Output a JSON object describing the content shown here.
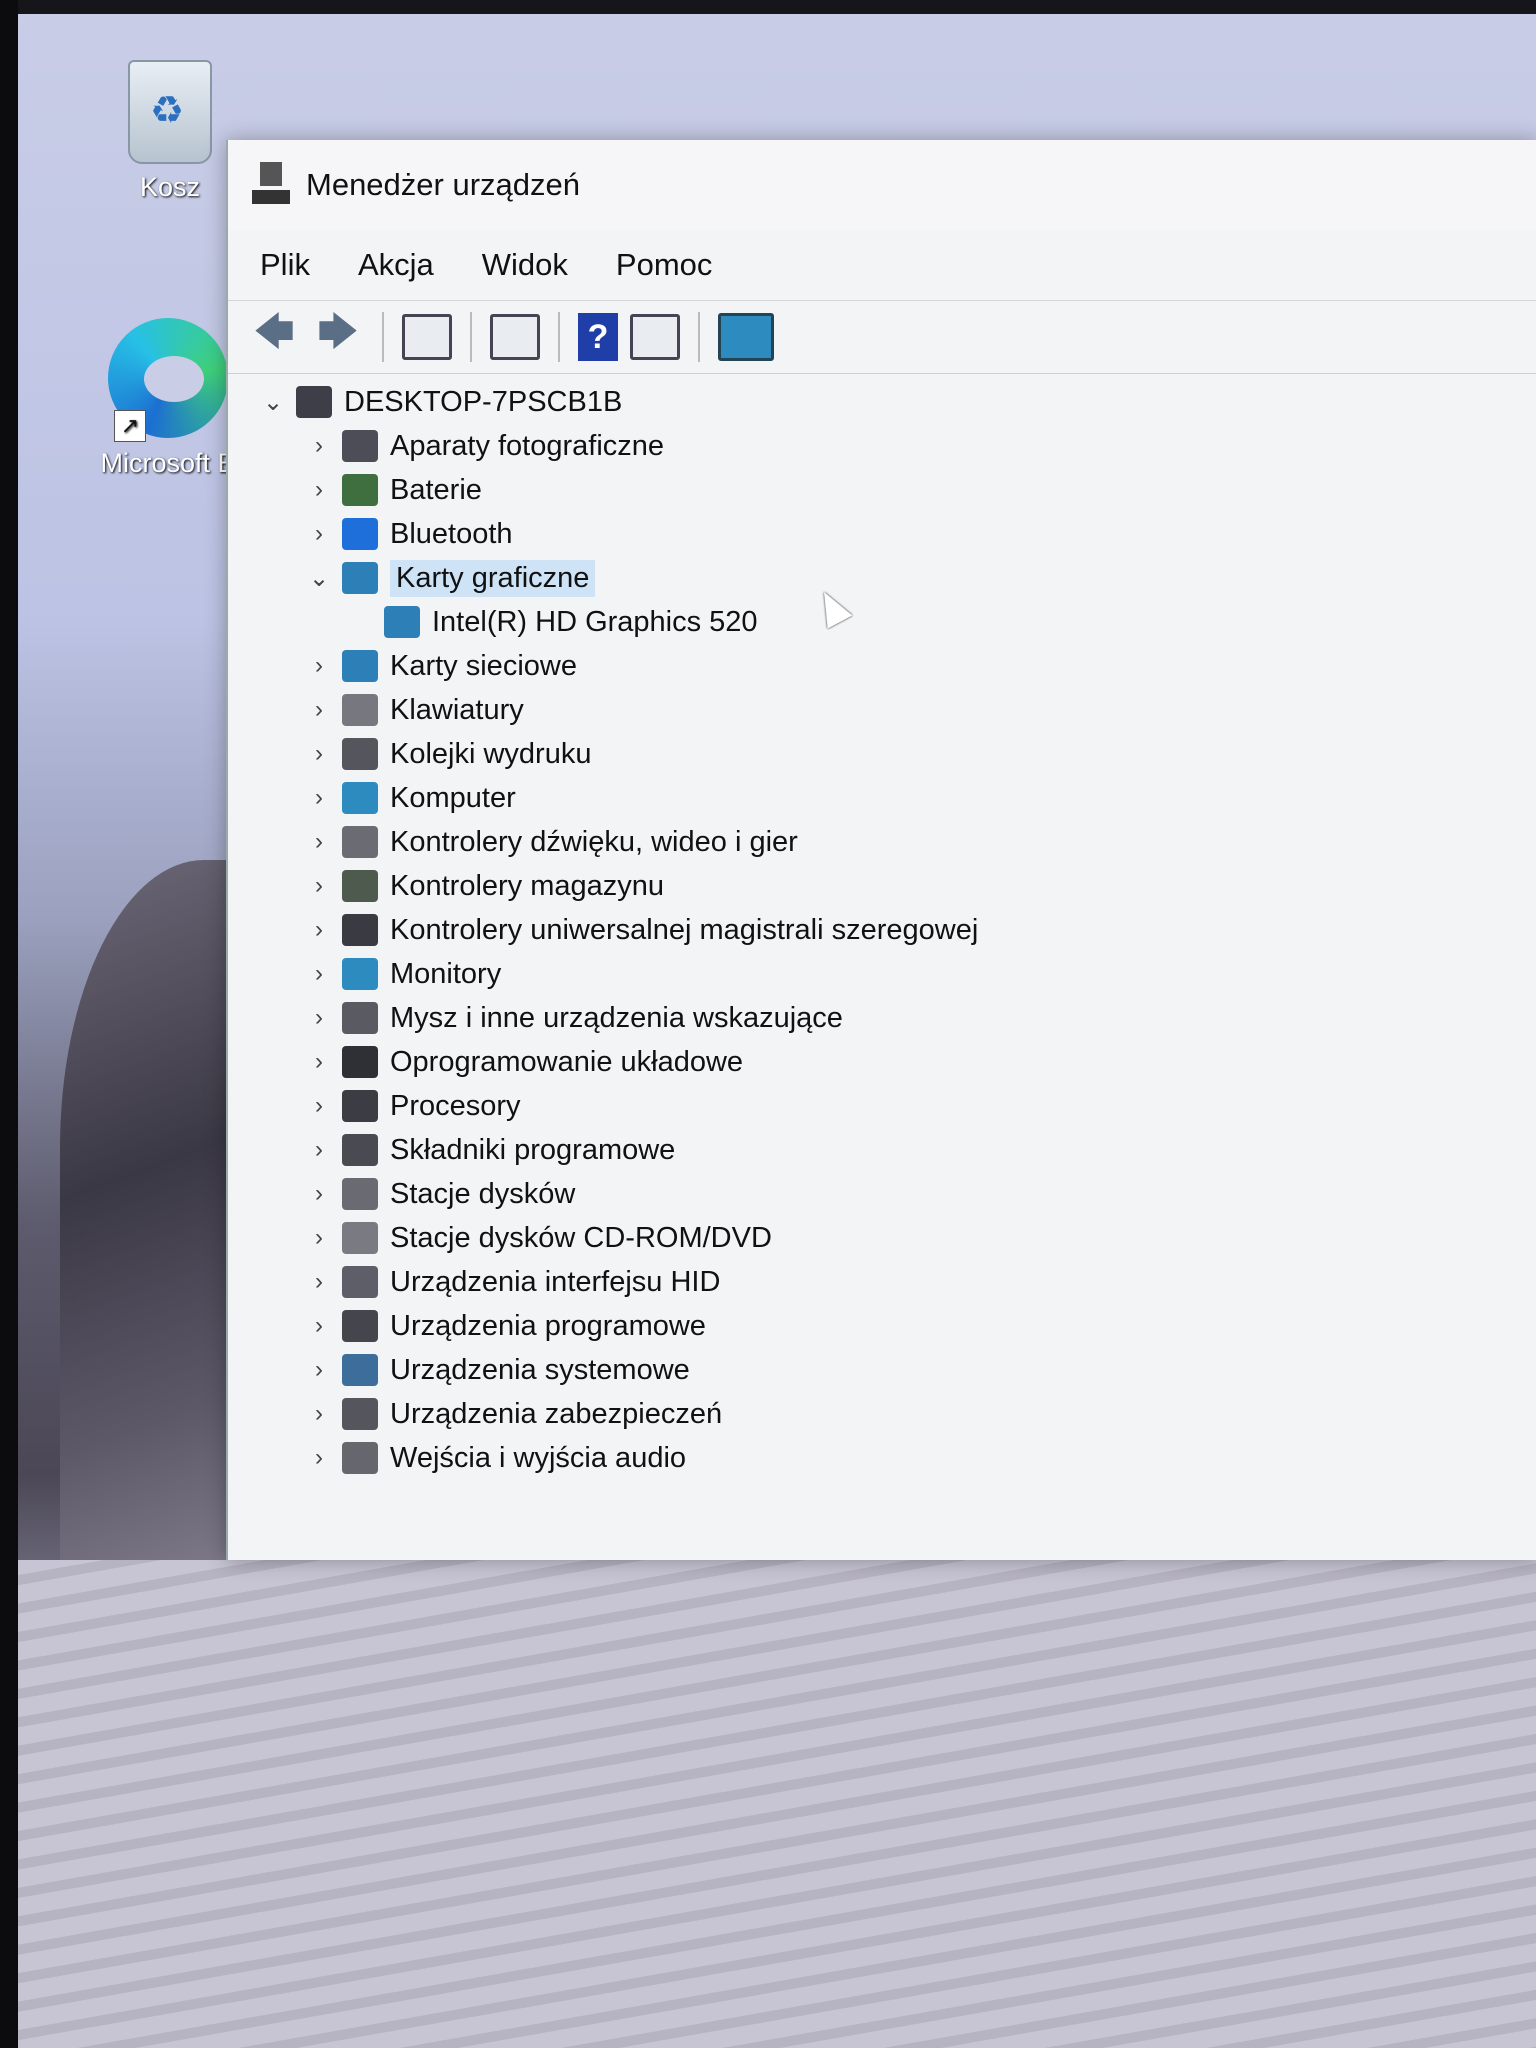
{
  "desktop": {
    "icons": [
      {
        "label": "Kosz",
        "icon": "recycle-bin-icon"
      },
      {
        "label": "Microsoft E",
        "icon": "edge-icon"
      }
    ]
  },
  "window": {
    "title": "Menedżer urządzeń",
    "menu": [
      "Plik",
      "Akcja",
      "Widok",
      "Pomoc"
    ],
    "toolbar": [
      "back-arrow-icon",
      "forward-arrow-icon",
      "properties-icon",
      "view-icon",
      "help-icon",
      "action-pane-icon",
      "scan-hardware-icon"
    ]
  },
  "tree": {
    "root": "DESKTOP-7PSCB1B",
    "items": [
      {
        "label": "Aparaty fotograficzne",
        "color": "#4d4d57"
      },
      {
        "label": "Baterie",
        "color": "#3f6e3f"
      },
      {
        "label": "Bluetooth",
        "color": "#1e6fd9"
      },
      {
        "label": "Karty graficzne",
        "color": "#2d7fb8",
        "expanded": true,
        "selected": true,
        "children": [
          "Intel(R) HD Graphics 520"
        ]
      },
      {
        "label": "Karty sieciowe",
        "color": "#2d7fb8"
      },
      {
        "label": "Klawiatury",
        "color": "#777780"
      },
      {
        "label": "Kolejki wydruku",
        "color": "#55555e"
      },
      {
        "label": "Komputer",
        "color": "#2d8bbf"
      },
      {
        "label": "Kontrolery dźwięku, wideo i gier",
        "color": "#6b6b74"
      },
      {
        "label": "Kontrolery magazynu",
        "color": "#4f5a4f"
      },
      {
        "label": "Kontrolery uniwersalnej magistrali szeregowej",
        "color": "#3a3a42"
      },
      {
        "label": "Monitory",
        "color": "#2d8bbf"
      },
      {
        "label": "Mysz i inne urządzenia wskazujące",
        "color": "#5a5a62"
      },
      {
        "label": "Oprogramowanie układowe",
        "color": "#2f2f36"
      },
      {
        "label": "Procesory",
        "color": "#3c3c44"
      },
      {
        "label": "Składniki programowe",
        "color": "#4a4a52"
      },
      {
        "label": "Stacje dysków",
        "color": "#6a6a72"
      },
      {
        "label": "Stacje dysków CD-ROM/DVD",
        "color": "#7a7a82"
      },
      {
        "label": "Urządzenia interfejsu HID",
        "color": "#5e5e68"
      },
      {
        "label": "Urządzenia programowe",
        "color": "#45454d"
      },
      {
        "label": "Urządzenia systemowe",
        "color": "#3d6d9a"
      },
      {
        "label": "Urządzenia zabezpieczeń",
        "color": "#55555d"
      },
      {
        "label": "Wejścia i wyjścia audio",
        "color": "#66666e"
      }
    ]
  }
}
